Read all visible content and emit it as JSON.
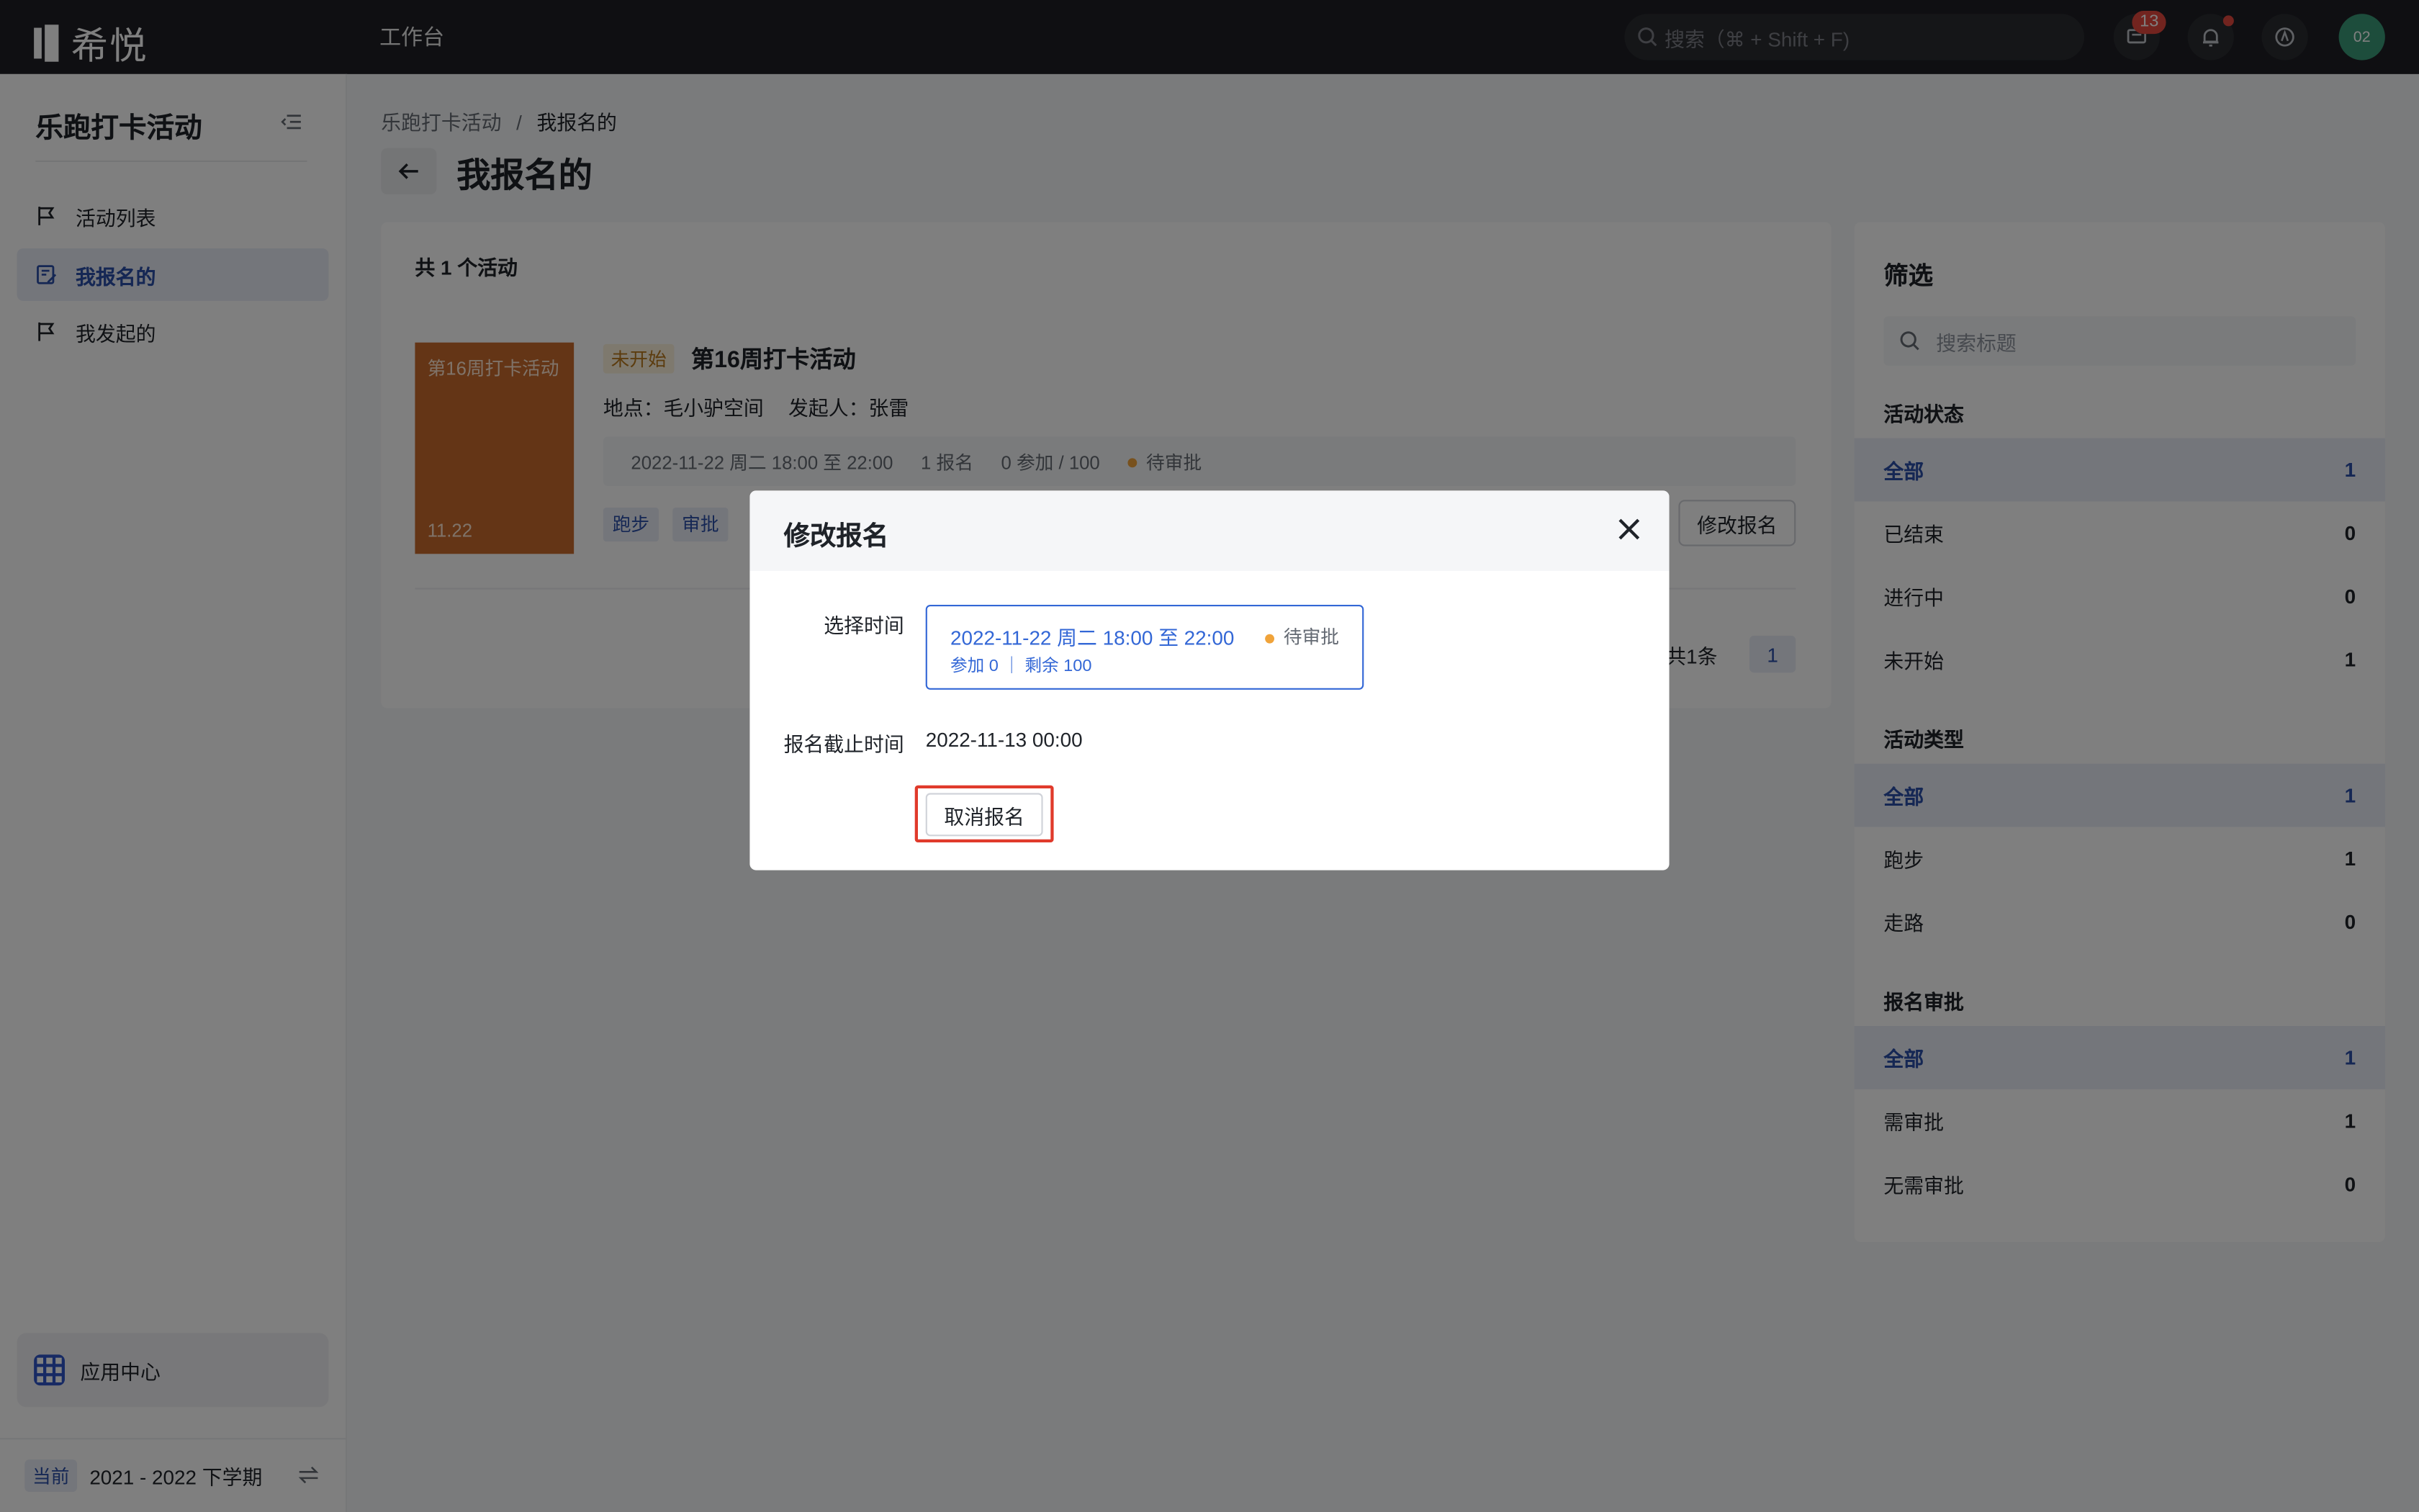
{
  "topbar": {
    "logo_text": "希悦",
    "workbench": "工作台",
    "search_placeholder": "搜索（⌘ + Shift + F)",
    "message_badge": "13",
    "avatar_text": "02"
  },
  "sidebar": {
    "app_title": "乐跑打卡活动",
    "items": [
      {
        "label": "活动列表",
        "icon": "flag-icon"
      },
      {
        "label": "我报名的",
        "icon": "signup-icon"
      },
      {
        "label": "我发起的",
        "icon": "flag-icon"
      }
    ],
    "app_center": "应用中心",
    "term_tag": "当前",
    "term": "2021 - 2022 下学期"
  },
  "main": {
    "breadcrumb": [
      "乐跑打卡活动",
      "我报名的"
    ],
    "breadcrumb_sep": "/",
    "title": "我报名的",
    "count_text": "共 1 个活动",
    "activity": {
      "cover_title": "第16周打卡活动",
      "cover_date": "11.22",
      "status": "未开始",
      "title": "第16周打卡活动",
      "location": "地点：毛小驴空间",
      "organizer": "发起人：张雷",
      "session_time": "2022-11-22 周二 18:00 至 22:00",
      "signups": "1 报名",
      "capacity": "0 参加 / 100",
      "session_status": "待审批",
      "tags": [
        "跑步",
        "审批"
      ],
      "edit_button": "修改报名"
    },
    "total": "共1条",
    "page": "1"
  },
  "filter": {
    "title": "筛选",
    "search_placeholder": "搜索标题",
    "groups": [
      {
        "name": "活动状态",
        "items": [
          {
            "label": "全部",
            "count": "1"
          },
          {
            "label": "已结束",
            "count": "0"
          },
          {
            "label": "进行中",
            "count": "0"
          },
          {
            "label": "未开始",
            "count": "1"
          }
        ]
      },
      {
        "name": "活动类型",
        "items": [
          {
            "label": "全部",
            "count": "1"
          },
          {
            "label": "跑步",
            "count": "1"
          },
          {
            "label": "走路",
            "count": "0"
          }
        ]
      },
      {
        "name": "报名审批",
        "items": [
          {
            "label": "全部",
            "count": "1"
          },
          {
            "label": "需审批",
            "count": "1"
          },
          {
            "label": "无需审批",
            "count": "0"
          }
        ]
      }
    ]
  },
  "modal": {
    "title": "修改报名",
    "select_time_label": "选择时间",
    "time_option": "2022-11-22 周二 18:00 至 22:00",
    "time_status": "待审批",
    "time_detail": "参加 0 ｜ 剩余 100",
    "deadline_label": "报名截止时间",
    "deadline_value": "2022-11-13 00:00",
    "cancel_button": "取消报名"
  },
  "colors": {
    "accent": "#2b4fa8",
    "topbar": "#1e1f24",
    "cover": "#c96b2c",
    "pending": "#f0a33a",
    "highlight": "#e03a2b"
  }
}
